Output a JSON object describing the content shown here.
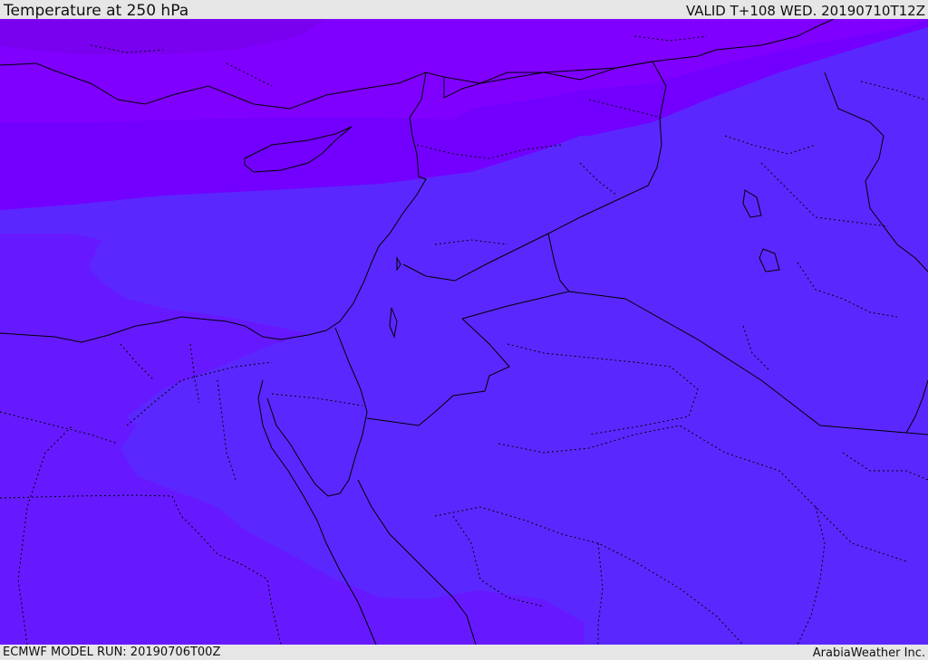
{
  "header": {
    "title": "Temperature at 250 hPa",
    "valid": "VALID T+108 WED. 20190710T12Z"
  },
  "footer": {
    "model_run": "ECMWF MODEL RUN: 20190706T00Z",
    "brand": "ArabiaWeather Inc."
  },
  "map": {
    "field": "temperature",
    "level": "250 hPa",
    "colors": {
      "coldest": "#8000ff",
      "cold": "#7300ff",
      "mid": "#6619ff",
      "warm": "#5a28ff",
      "coastline": "#000000",
      "border": "#000000"
    }
  }
}
